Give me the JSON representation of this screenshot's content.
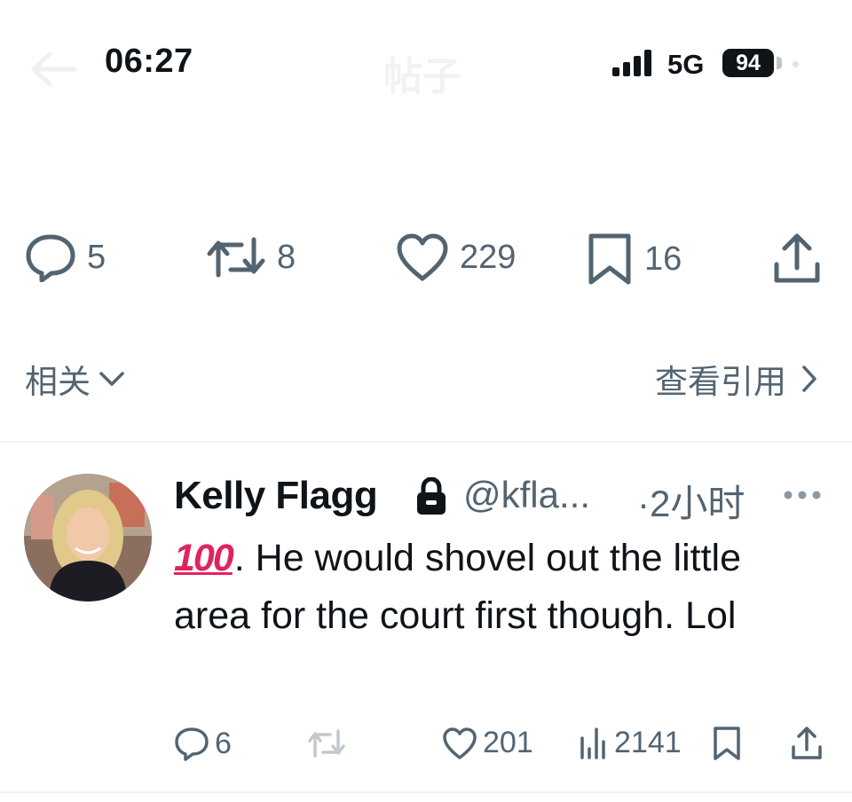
{
  "status_bar": {
    "time": "06:27",
    "network": "5G",
    "battery": "94",
    "faded_title": "帖子"
  },
  "actions": {
    "reply_count": "5",
    "retweet_count": "8",
    "like_count": "229",
    "bookmark_count": "16"
  },
  "related": {
    "label": "相关",
    "quotes_label": "查看引用"
  },
  "reply_tweet": {
    "author_name": "Kelly Flagg",
    "handle": "@kfla...",
    "separator": "·",
    "time_ago": "2小时",
    "emoji_text": "100",
    "text": ". He would shovel out the little area for the court first though. Lol",
    "reply_count": "6",
    "like_count": "201",
    "view_count": "2141"
  },
  "colors": {
    "text": "#0f1419",
    "muted": "#536471",
    "divider": "#eff3f4",
    "hundred_emoji": "#e0245e"
  },
  "icons": [
    "back-arrow-icon",
    "signal-icon",
    "battery-icon",
    "reply-icon",
    "retweet-icon",
    "like-icon",
    "bookmark-icon",
    "share-icon",
    "chevron-down-icon",
    "chevron-right-icon",
    "lock-icon",
    "more-icon",
    "views-icon"
  ]
}
